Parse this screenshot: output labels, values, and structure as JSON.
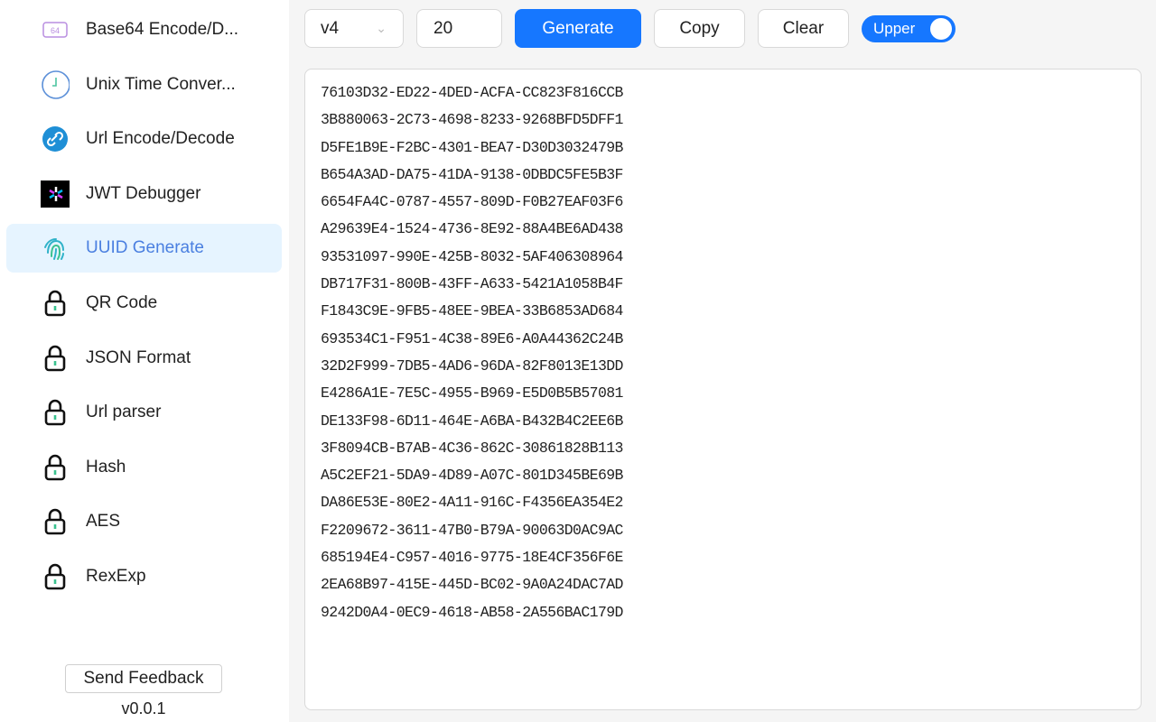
{
  "sidebar": {
    "items": [
      {
        "label": "Base64 Encode/D...",
        "icon": "base64-icon"
      },
      {
        "label": "Unix Time Conver...",
        "icon": "clock-icon"
      },
      {
        "label": "Url Encode/Decode",
        "icon": "link-icon"
      },
      {
        "label": "JWT Debugger",
        "icon": "jwt-icon"
      },
      {
        "label": "UUID Generate",
        "icon": "fingerprint-icon",
        "active": true
      },
      {
        "label": "QR Code",
        "icon": "lock-icon"
      },
      {
        "label": "JSON Format",
        "icon": "lock-icon"
      },
      {
        "label": "Url parser",
        "icon": "lock-icon"
      },
      {
        "label": "Hash",
        "icon": "lock-icon"
      },
      {
        "label": "AES",
        "icon": "lock-icon"
      },
      {
        "label": "RexExp",
        "icon": "lock-icon"
      }
    ],
    "feedback": "Send Feedback",
    "version": "v0.0.1",
    "base64_glyph": "64"
  },
  "toolbar": {
    "version": "v4",
    "count": "20",
    "generate": "Generate",
    "copy": "Copy",
    "clear": "Clear",
    "toggle": "Upper",
    "toggle_on": true,
    "accent": "#1677ff"
  },
  "output": [
    "76103D32-ED22-4DED-ACFA-CC823F816CCB",
    "3B880063-2C73-4698-8233-9268BFD5DFF1",
    "D5FE1B9E-F2BC-4301-BEA7-D30D3032479B",
    "B654A3AD-DA75-41DA-9138-0DBDC5FE5B3F",
    "6654FA4C-0787-4557-809D-F0B27EAF03F6",
    "A29639E4-1524-4736-8E92-88A4BE6AD438",
    "93531097-990E-425B-8032-5AF406308964",
    "DB717F31-800B-43FF-A633-5421A1058B4F",
    "F1843C9E-9FB5-48EE-9BEA-33B6853AD684",
    "693534C1-F951-4C38-89E6-A0A44362C24B",
    "32D2F999-7DB5-4AD6-96DA-82F8013E13DD",
    "E4286A1E-7E5C-4955-B969-E5D0B5B57081",
    "DE133F98-6D11-464E-A6BA-B432B4C2EE6B",
    "3F8094CB-B7AB-4C36-862C-30861828B113",
    "A5C2EF21-5DA9-4D89-A07C-801D345BE69B",
    "DA86E53E-80E2-4A11-916C-F4356EA354E2",
    "F2209672-3611-47B0-B79A-90063D0AC9AC",
    "685194E4-C957-4016-9775-18E4CF356F6E",
    "2EA68B97-415E-445D-BC02-9A0A24DAC7AD",
    "9242D0A4-0EC9-4618-AB58-2A556BAC179D"
  ]
}
